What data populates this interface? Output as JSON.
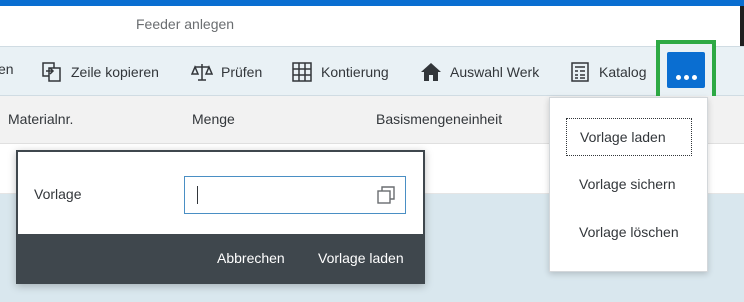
{
  "header": {
    "title": "Feeder anlegen"
  },
  "toolbar": {
    "items": [
      {
        "label": "en",
        "icon": "truncated-icon"
      },
      {
        "label": "Zeile kopieren",
        "icon": "copy-row-icon"
      },
      {
        "label": "Prüfen",
        "icon": "scale-icon"
      },
      {
        "label": "Kontierung",
        "icon": "grid-icon"
      },
      {
        "label": "Auswahl Werk",
        "icon": "house-icon"
      },
      {
        "label": "Katalog",
        "icon": "catalog-icon"
      }
    ],
    "more_icon": "overflow-icon",
    "highlight_color": "#2ea944",
    "accent_color": "#0a6ed1"
  },
  "table": {
    "columns": [
      "Materialnr.",
      "Menge",
      "Basismengeneinheit"
    ]
  },
  "dialog": {
    "field_label": "Vorlage",
    "field_value": "",
    "value_help_icon": "value-help-icon",
    "cancel_label": "Abbrechen",
    "confirm_label": "Vorlage laden"
  },
  "overflow_menu": {
    "items": [
      "Vorlage laden",
      "Vorlage sichern",
      "Vorlage löschen"
    ],
    "focused_index": 0
  }
}
